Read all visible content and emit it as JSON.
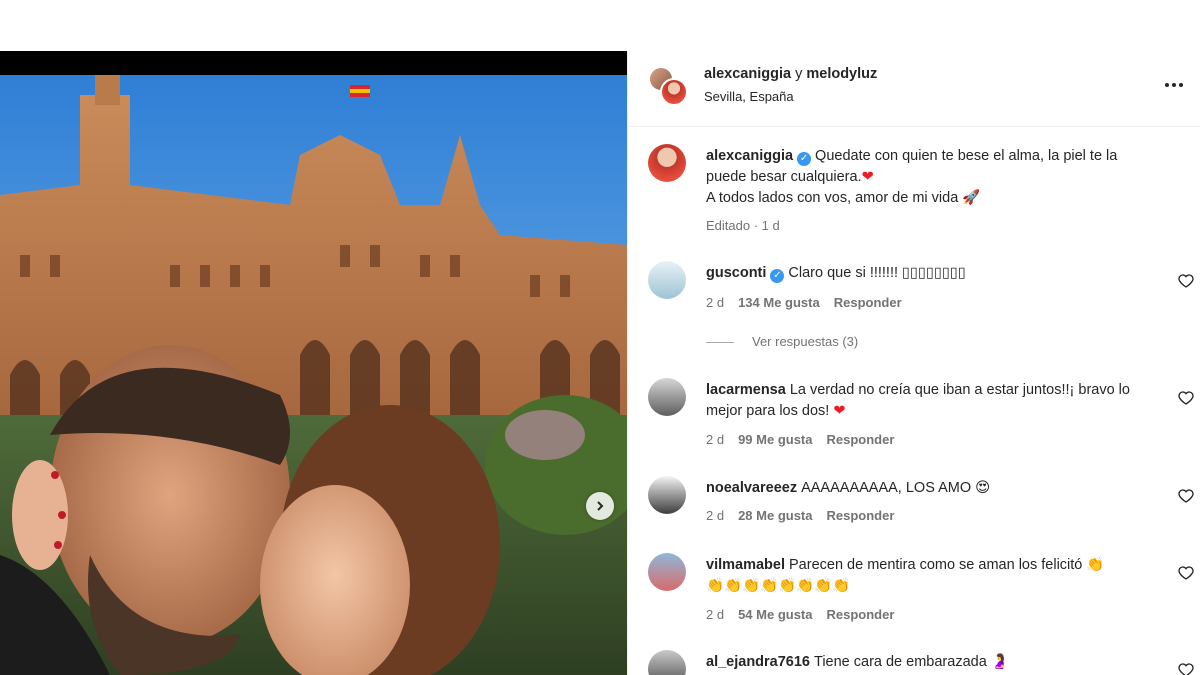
{
  "post": {
    "authors": "alexcaniggia",
    "conjunction": "y",
    "coauthor": "melodyluz",
    "location": "Sevilla, España"
  },
  "caption": {
    "username": "alexcaniggia",
    "text_line1": "Quedate con quien te bese el alma, la piel te la puede besar cualquiera.",
    "heart": "❤",
    "text_line2": "A todos lados con vos, amor de mi vida",
    "rocket": "🚀",
    "meta": "Editado · 1 d"
  },
  "comments": [
    {
      "username": "gusconti",
      "verified": true,
      "text": "Claro que si !!!!!!! ▯▯▯▯▯▯▯▯",
      "age": "2 d",
      "likes": "134 Me gusta",
      "reply": "Responder"
    },
    {
      "username": "lacarmensa",
      "verified": false,
      "text": "La verdad no creía que iban a estar juntos!!¡ bravo lo mejor para los dos!",
      "emoji": "❤",
      "age": "2 d",
      "likes": "99 Me gusta",
      "reply": "Responder"
    },
    {
      "username": "noealvareeez",
      "verified": false,
      "text": "AAAAAAAAAA, LOS AMO",
      "emoji": "😍",
      "age": "2 d",
      "likes": "28 Me gusta",
      "reply": "Responder"
    },
    {
      "username": "vilmamabel",
      "verified": false,
      "text": "Parecen de mentira como se aman los felicitó",
      "emoji": "👏",
      "emoji_row": "👏👏👏👏👏👏👏👏",
      "age": "2 d",
      "likes": "54 Me gusta",
      "reply": "Responder"
    },
    {
      "username": "al_ejandra7616",
      "verified": false,
      "text": "Tiene cara de embarazada",
      "emoji": "🤰"
    }
  ],
  "view_replies": "Ver respuestas (3)",
  "icons": {
    "more": "more-options-icon",
    "heart": "heart-outline-icon",
    "next": "chevron-right-icon",
    "verified": "verified-badge-icon"
  },
  "colors": {
    "text": "#262626",
    "secondary": "#737373",
    "verified": "#3897f0",
    "border": "#efefef"
  }
}
